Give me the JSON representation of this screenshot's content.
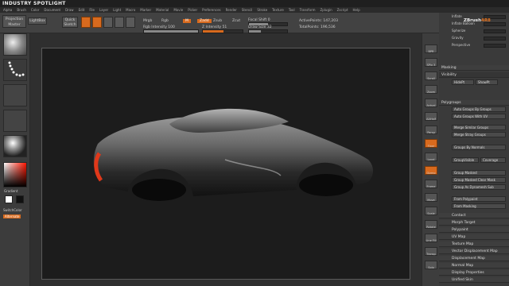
{
  "app": {
    "title": "Industry Spotlight",
    "logo_prefix": "ZBrush",
    "logo_suffix": "4R8"
  },
  "menu": [
    "Alpha",
    "Brush",
    "Color",
    "Document",
    "Draw",
    "Edit",
    "File",
    "Layer",
    "Light",
    "Macro",
    "Marker",
    "Material",
    "Movie",
    "Picker",
    "Preferences",
    "Render",
    "Stencil",
    "Stroke",
    "Texture",
    "Tool",
    "Transform",
    "Zplugin",
    "Zscript",
    "Help"
  ],
  "toolbar": {
    "projection_master_label": "Projection Master",
    "lightbox_label": "LightBox",
    "quick_sketch_label": "Quick Sketch",
    "edit_label": "Edit",
    "draw_label": "Draw",
    "move_label": "Move",
    "scale_label": "Scale",
    "rotate_label": "Rotate",
    "mrgb_label": "Mrgb",
    "rgb_label": "Rgb",
    "m_label": "M",
    "zadd_label": "Zadd",
    "zsub_label": "Zsub",
    "zcut_label": "Zcut",
    "rgb_intensity_label": "Rgb Intensity 100",
    "z_intensity_label": "Z Intensity 51",
    "focal_shift_label": "Focal Shift 0",
    "draw_size_label": "Draw Size 32",
    "active_points_label": "ActivePoints: 147,203",
    "total_points_label": "TotalPoints: 196,536"
  },
  "left_panel": {
    "gradient_label": "Gradient",
    "switch_color_label": "SwitchColor",
    "alternate_label": "Alternate"
  },
  "right_panel": {
    "items_top": [
      "Inflate",
      "Inflate Balloon",
      "Spherize",
      "Gravity",
      "Perspective"
    ],
    "masking_label": "Masking",
    "visibility_label": "Visibility",
    "hide_pt_label": "HidePt",
    "show_pt_label": "ShowPt",
    "polygroups_label": "Polygroups",
    "auto_groups_label": "Auto Groups By Groups",
    "auto_groups_uv_label": "Auto Groups With UV",
    "merge_similar_label": "Merge Similar Groups",
    "merge_stray_label": "Merge Stray Groups",
    "groups_by_normals_label": "Groups By Normals",
    "groupvisible_label": "GroupVisible",
    "coverage_label": "Coverage",
    "group_masked_label": "Group Masked",
    "group_masked_clear_label": "Group Masked Clear Mask",
    "group_as_dynamesh_label": "Group As Dynamesh Sub",
    "from_polypaint_label": "From Polypaint",
    "from_masking_label": "From Masking",
    "contact_label": "Contact",
    "morph_target_label": "Morph Target",
    "polypaint_label": "Polypaint",
    "uv_map_label": "UV Map",
    "texture_map_label": "Texture Map",
    "vector_disp_label": "Vector Displacement Map",
    "displacement_label": "Displacement Map",
    "normal_map_label": "Normal Map",
    "display_props_label": "Display Properties",
    "unified_skin_label": "Unified Skin"
  },
  "vertical_tools": [
    "BPR",
    "SPix 3",
    "Scroll",
    "Zoom",
    "Actual",
    "AAHalf",
    "Persp",
    "Floor",
    "Local",
    "Gizmo",
    "Frame",
    "Move",
    "Scale",
    "Rotate",
    "Line Fill",
    "Transp",
    "Solo"
  ],
  "colors": {
    "accent": "#d86a1e",
    "bg": "#3b3b3b",
    "canvas": "#1c1c1c"
  }
}
